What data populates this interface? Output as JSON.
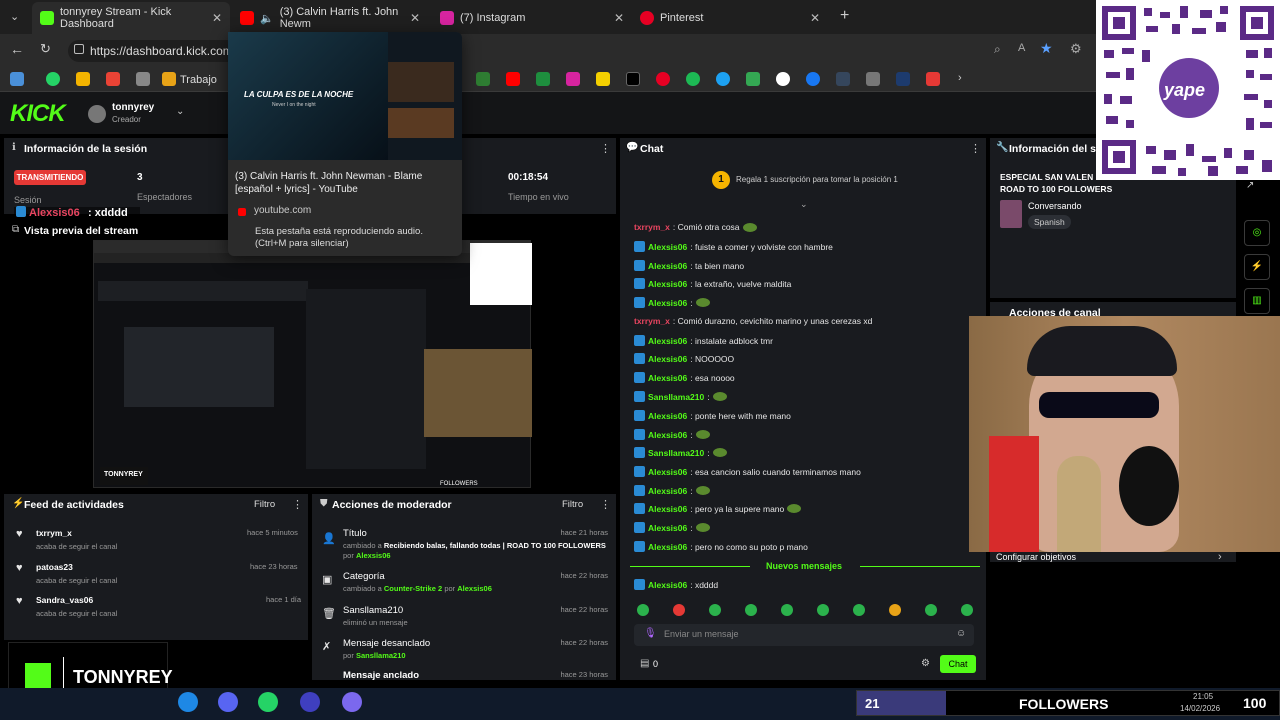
{
  "browser": {
    "tabs": [
      {
        "title": "tonnyrey Stream - Kick Dashboard",
        "icon": "kick-icon",
        "color": "#53fc18"
      },
      {
        "title": "(3) Calvin Harris ft. John Newm",
        "icon": "youtube-icon",
        "color": "#ff0000"
      },
      {
        "title": "(7) Instagram",
        "icon": "instagram-icon",
        "color": "#d6249f"
      },
      {
        "title": "Pinterest",
        "icon": "pinterest-icon",
        "color": "#e60023"
      }
    ],
    "url": "https://dashboard.kick.com",
    "bookmark_label": "Trabajo"
  },
  "tab_preview": {
    "video_title": "LA CULPA ES DE LA NOCHE",
    "video_sub": "Never I on the night",
    "title": "(3) Calvin Harris ft. John Newman - Blame [español + lyrics] - YouTube",
    "domain": "youtube.com",
    "audio_note": "Esta pestaña está reproduciendo audio. (Ctrl+M para silenciar)"
  },
  "header": {
    "logo": "KICK",
    "username": "tonnyrey",
    "role": "Creador"
  },
  "session": {
    "title": "Información de la sesión",
    "live_badge": "TRANSMITIENDO",
    "viewers": "3",
    "viewers_label": "Espectadores",
    "session_label": "Sesión",
    "uptime": "00:18:54",
    "uptime_label": "Tiempo en vivo",
    "overlay_user": "Alexsis06",
    "overlay_msg": ": xdddd"
  },
  "preview": {
    "title": "Vista previa del stream",
    "thumb_brand": "TONNYREY",
    "thumb_followers": "FOLLOWERS"
  },
  "activity": {
    "title": "Feed de actividades",
    "filter": "Filtro",
    "items": [
      {
        "user": "txrrym_x",
        "action": "acaba de seguir el canal",
        "time": "hace 5 minutos"
      },
      {
        "user": "patoas23",
        "action": "acaba de seguir el canal",
        "time": "hace 23 horas"
      },
      {
        "user": "Sandra_vas06",
        "action": "acaba de seguir el canal",
        "time": "hace 1 día"
      }
    ]
  },
  "mod": {
    "title": "Acciones de moderador",
    "filter": "Filtro",
    "items": [
      {
        "title": "Título",
        "line1": "cambiado a",
        "bold": "Recibiendo balas, fallando todas | ROAD TO 100 FOLLOWERS",
        "by": "por",
        "user": "Alexsis06",
        "time": "hace 21 horas"
      },
      {
        "title": "Categoría",
        "line1": "cambiado a",
        "bold": "Counter-Strike 2",
        "by": "por",
        "user": "Alexsis06",
        "time": "hace 22 horas"
      },
      {
        "title": "Sansllama210",
        "line1": "eliminó un mensaje",
        "bold": "",
        "by": "",
        "user": "",
        "time": "hace 22 horas"
      },
      {
        "title": "Mensaje desanclado",
        "line1": "",
        "bold": "",
        "by": "por",
        "user": "Sansllama210",
        "time": "hace 22 horas"
      },
      {
        "title": "Mensaje anclado",
        "line1": "",
        "bold": "",
        "by": "",
        "user": "",
        "time": "hace 23 horas"
      }
    ]
  },
  "chat": {
    "title": "Chat",
    "promo_num": "1",
    "promo": "Regala 1 suscripción para tomar la posición 1",
    "messages": [
      {
        "user": "txrrym_x",
        "text": ": Comió otra cosa",
        "red": true,
        "emote": true
      },
      {
        "user": "Alexsis06",
        "text": ": fuiste a comer y volviste con hambre"
      },
      {
        "user": "Alexsis06",
        "text": ": ta bien mano"
      },
      {
        "user": "Alexsis06",
        "text": ": la extraño, vuelve maldita"
      },
      {
        "user": "Alexsis06",
        "text": ":",
        "emote": true
      },
      {
        "user": "txrrym_x",
        "text": ": Comió durazno, cevichito marino y unas cerezas xd",
        "red": true
      },
      {
        "user": "Alexsis06",
        "text": ": instalate adblock tmr"
      },
      {
        "user": "Alexsis06",
        "text": ": NOOOOO"
      },
      {
        "user": "Alexsis06",
        "text": ": esa noooo"
      },
      {
        "user": "Sansllama210",
        "text": ":",
        "emote": true
      },
      {
        "user": "Alexsis06",
        "text": ": ponte here with me mano"
      },
      {
        "user": "Alexsis06",
        "text": ":",
        "emote": true
      },
      {
        "user": "Sansllama210",
        "text": ":",
        "emote": true
      },
      {
        "user": "Alexsis06",
        "text": ": esa cancion salio cuando terminamos mano"
      },
      {
        "user": "Alexsis06",
        "text": ":",
        "emote": true
      },
      {
        "user": "Alexsis06",
        "text": ": pero ya la supere mano",
        "emote": true
      },
      {
        "user": "Alexsis06",
        "text": ":",
        "emote": true
      },
      {
        "user": "Alexsis06",
        "text": ": pero no como su poto p mano"
      }
    ],
    "new_label": "Nuevos mensajes",
    "last": {
      "user": "Alexsis06",
      "text": ": xdddd"
    },
    "placeholder": "Enviar un mensaje",
    "points": "0",
    "send": "Chat"
  },
  "stream_info": {
    "title": "Información del stre",
    "stream_title": "ESPECIAL SAN VALEN",
    "stream_title2": "ROAD TO 100 FOLLOWERS",
    "category": "Conversando",
    "language": "Spanish",
    "actions_title": "Acciones de canal",
    "goals": "Configurar objetivos"
  },
  "overlay": {
    "brand": "TONNYREY",
    "qr_label": "yape",
    "followers_count": "21",
    "followers_label": "FOLLOWERS",
    "goal": "100",
    "clock": "21:05",
    "date": "14/02/2026"
  }
}
